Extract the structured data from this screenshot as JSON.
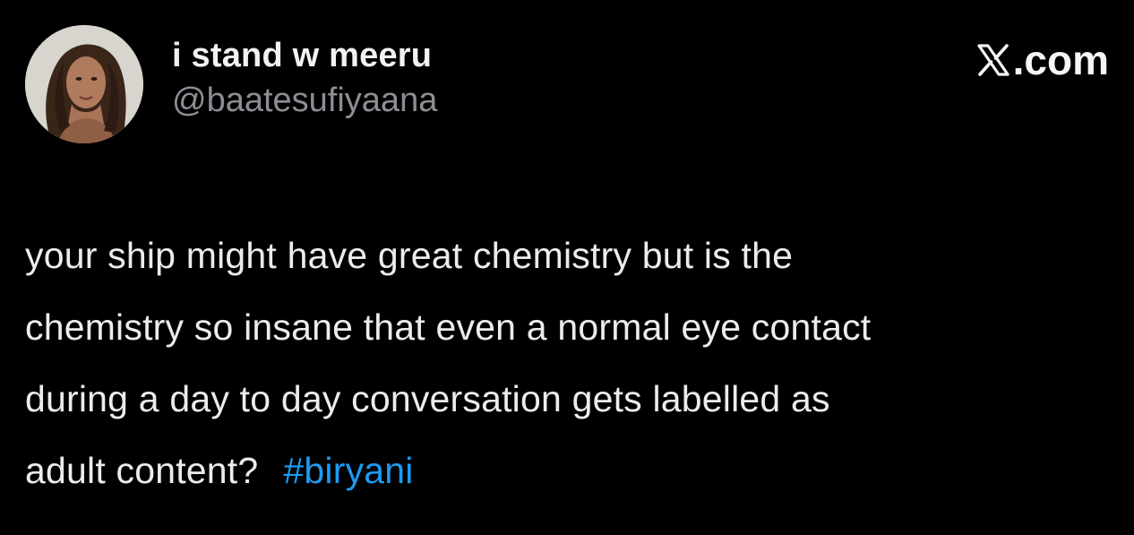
{
  "author": {
    "display_name": "i stand w meeru",
    "handle": "@baatesufiyaana",
    "avatar_description": "profile photo"
  },
  "brand": {
    "label": ".com",
    "icon": "x-logo-icon"
  },
  "tweet": {
    "lines": [
      "your ship might have great chemistry but is the",
      "chemistry so insane that even a normal eye contact",
      "during a day to day conversation gets labelled as",
      "adult content?"
    ],
    "hashtag": "#biryani"
  },
  "colors": {
    "background": "#000000",
    "text": "#ececec",
    "secondary_text": "#8b8f94",
    "link": "#1d9bf0"
  }
}
